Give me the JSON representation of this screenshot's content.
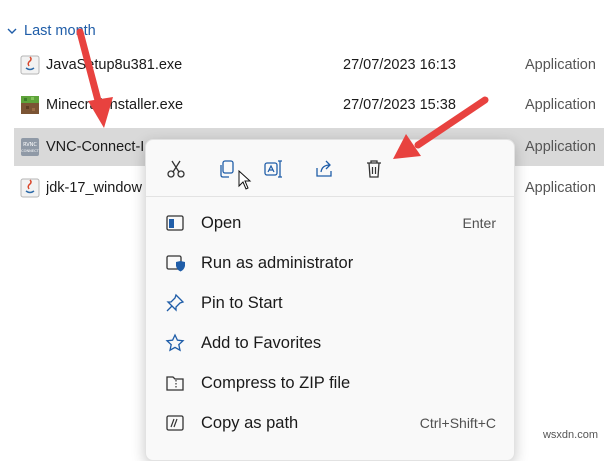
{
  "group": {
    "label": "Last month"
  },
  "files": [
    {
      "name": "JavaSetup8u381.exe",
      "date": "27/07/2023 16:13",
      "type": "Application",
      "icon": "java-icon"
    },
    {
      "name": "MinecraftInstaller.exe",
      "date": "27/07/2023 15:38",
      "type": "Application",
      "icon": "minecraft-icon"
    },
    {
      "name": "VNC-Connect-I",
      "date": "",
      "type": "Application",
      "icon": "vnc-icon",
      "icon_text": "RVNC CONNECT"
    },
    {
      "name": "jdk-17_window",
      "date": "",
      "type": "Application",
      "icon": "java-icon"
    }
  ],
  "toolbar": {
    "items": [
      {
        "name": "cut",
        "icon": "scissors-icon"
      },
      {
        "name": "copy",
        "icon": "copy-icon"
      },
      {
        "name": "rename",
        "icon": "rename-icon"
      },
      {
        "name": "share",
        "icon": "share-icon"
      },
      {
        "name": "delete",
        "icon": "trash-icon"
      }
    ]
  },
  "menu": {
    "items": [
      {
        "label": "Open",
        "shortcut": "Enter",
        "icon": "open-window-icon"
      },
      {
        "label": "Run as administrator",
        "shortcut": "",
        "icon": "shield-window-icon"
      },
      {
        "label": "Pin to Start",
        "shortcut": "",
        "icon": "pin-icon"
      },
      {
        "label": "Add to Favorites",
        "shortcut": "",
        "icon": "star-icon"
      },
      {
        "label": "Compress to ZIP file",
        "shortcut": "",
        "icon": "zip-folder-icon"
      },
      {
        "label": "Copy as path",
        "shortcut": "Ctrl+Shift+C",
        "icon": "copy-path-icon"
      }
    ]
  },
  "watermark": "wsxdn.com",
  "colors": {
    "accent": "#1f5da8",
    "arrow": "#e8423f",
    "selection": "#d9d9d9",
    "menu_bg": "#f9f9f9"
  }
}
